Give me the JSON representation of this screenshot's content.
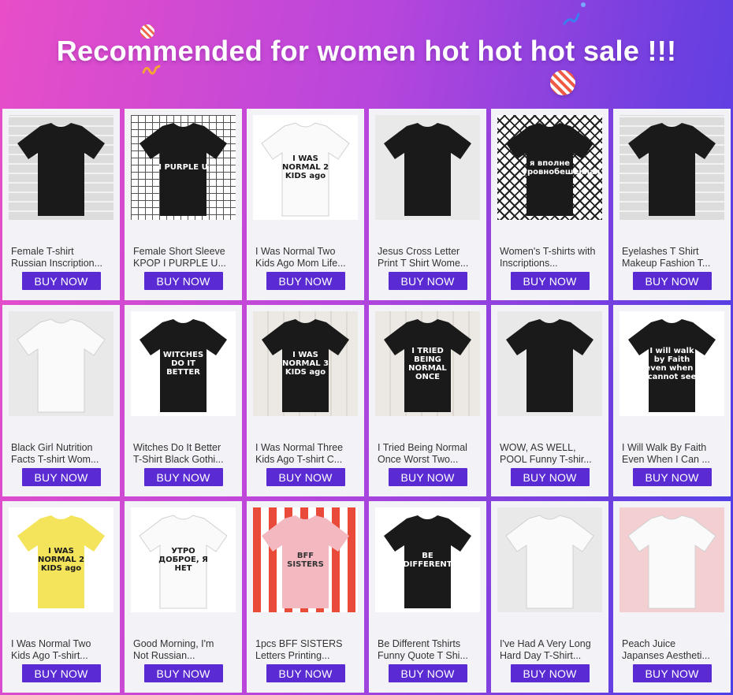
{
  "banner": {
    "title": "Recommended for women hot hot hot sale !!!"
  },
  "colors": {
    "button": "#5a2bd2",
    "card": "#f3f3f7",
    "banner_gradient_start": "#e84ec8",
    "banner_gradient_end": "#4b3fe6"
  },
  "products": [
    {
      "title": "Female T-shirt Russian Inscription...",
      "button": "BUY NOW",
      "print": "",
      "tee": "black",
      "bg": "brick"
    },
    {
      "title": "Female Short Sleeve KPOP I PURPLE U...",
      "button": "BUY NOW",
      "print": "I PURPLE U",
      "tee": "black",
      "bg": "grid"
    },
    {
      "title": "I Was Normal Two Kids Ago Mom Life...",
      "button": "BUY NOW",
      "print": "I WAS NORMAL 2 KIDS ago",
      "tee": "white",
      "bg": "white"
    },
    {
      "title": "Jesus Cross Letter Print T Shirt Wome...",
      "button": "BUY NOW",
      "print": "",
      "tee": "black",
      "bg": "light"
    },
    {
      "title": "Women's T-shirts with Inscriptions...",
      "button": "BUY NOW",
      "print": "я вполне\nуровнобешенная",
      "tee": "black",
      "bg": "check"
    },
    {
      "title": "Eyelashes T Shirt Makeup Fashion T...",
      "button": "BUY NOW",
      "print": "",
      "tee": "black",
      "bg": "brick"
    },
    {
      "title": "Black Girl Nutrition Facts T-shirt Wom...",
      "button": "BUY NOW",
      "print": "",
      "tee": "white",
      "bg": "light"
    },
    {
      "title": "Witches Do It Better T-Shirt Black Gothi...",
      "button": "BUY NOW",
      "print": "WITCHES DO IT BETTER",
      "tee": "black",
      "bg": "white"
    },
    {
      "title": "I Was Normal Three Kids Ago T-shirt C...",
      "button": "BUY NOW",
      "print": "I WAS NORMAL 3 KIDS ago",
      "tee": "black",
      "bg": "wood"
    },
    {
      "title": "I Tried Being Normal Once Worst Two...",
      "button": "BUY NOW",
      "print": "I TRIED BEING NORMAL ONCE",
      "tee": "black",
      "bg": "wood"
    },
    {
      "title": "WOW, AS WELL, POOL Funny T-shir...",
      "button": "BUY NOW",
      "print": "",
      "tee": "black",
      "bg": "light"
    },
    {
      "title": "I Will Walk By Faith Even When I Can ...",
      "button": "BUY NOW",
      "print": "I will walk by Faith even when I cannot see",
      "tee": "black",
      "bg": "white"
    },
    {
      "title": "I Was Normal Two Kids Ago T-shirt...",
      "button": "BUY NOW",
      "print": "I WAS NORMAL 2 KIDS ago",
      "tee": "yellow",
      "bg": "white"
    },
    {
      "title": "Good Morning, I'm Not Russian...",
      "button": "BUY NOW",
      "print": "УТРО ДОБРОЕ, Я НЕТ",
      "tee": "white",
      "bg": "white"
    },
    {
      "title": "1pcs BFF SISTERS Letters Printing...",
      "button": "BUY NOW",
      "print": "BFF SISTERS",
      "tee": "pink",
      "bg": "stripe"
    },
    {
      "title": "Be Different Tshirts Funny Quote T Shi...",
      "button": "BUY NOW",
      "print": "BE DIFFERENT",
      "tee": "black",
      "bg": "white"
    },
    {
      "title": "I've Had A Very Long Hard Day T-Shirt...",
      "button": "BUY NOW",
      "print": "",
      "tee": "white",
      "bg": "light"
    },
    {
      "title": "Peach Juice Japanses Aestheti...",
      "button": "BUY NOW",
      "print": "",
      "tee": "white",
      "bg": "pink"
    }
  ]
}
